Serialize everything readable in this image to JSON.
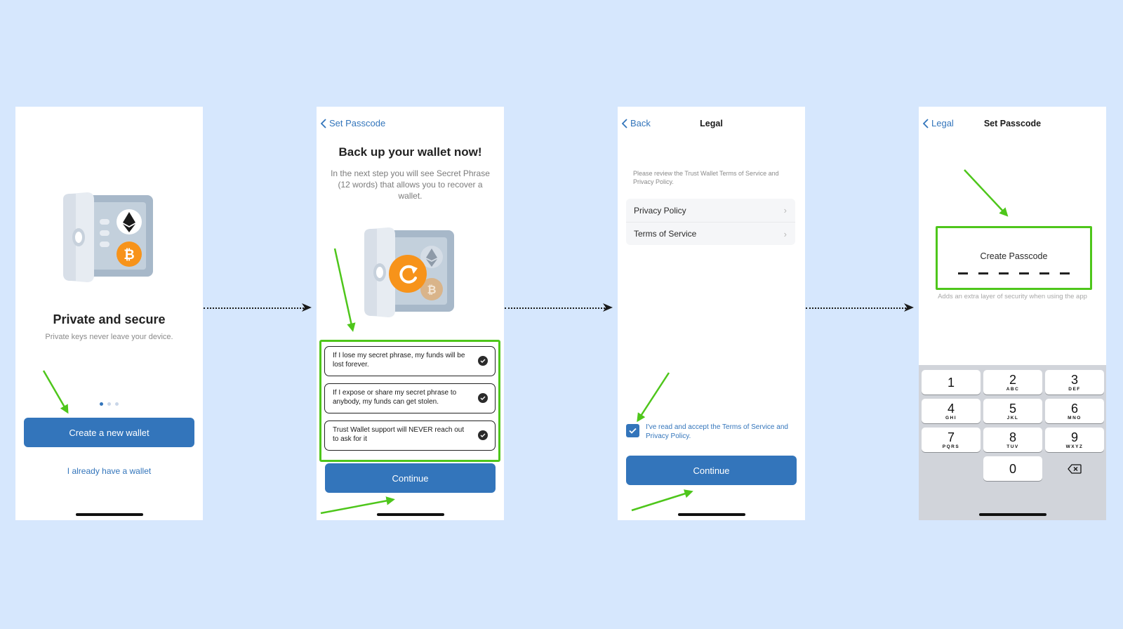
{
  "screen1": {
    "title": "Private and secure",
    "subtitle": "Private keys never leave your device.",
    "create_button": "Create a new wallet",
    "have_wallet_link": "I already have a wallet"
  },
  "screen2": {
    "back_label": "Set Passcode",
    "title": "Back up your wallet now!",
    "description": "In the next step you will see Secret Phrase (12 words) that allows you to recover a wallet.",
    "agreements": [
      "If I lose my secret phrase, my funds will be lost forever.",
      "If I expose or share my secret phrase to anybody, my funds can get stolen.",
      "Trust Wallet support will NEVER reach out to ask for it"
    ],
    "continue_button": "Continue"
  },
  "screen3": {
    "back_label": "Back",
    "title": "Legal",
    "review_text": "Please review the Trust Wallet Terms of Service and Privacy Policy.",
    "rows": [
      "Privacy Policy",
      "Terms of Service"
    ],
    "accept_text": "I've read and accept the Terms of Service and Privacy Policy.",
    "continue_button": "Continue"
  },
  "screen4": {
    "back_label": "Legal",
    "title": "Set Passcode",
    "create_label": "Create Passcode",
    "help_text": "Adds an extra layer of security when using the app",
    "keys": [
      {
        "num": "1",
        "letters": ""
      },
      {
        "num": "2",
        "letters": "ABC"
      },
      {
        "num": "3",
        "letters": "DEF"
      },
      {
        "num": "4",
        "letters": "GHI"
      },
      {
        "num": "5",
        "letters": "JKL"
      },
      {
        "num": "6",
        "letters": "MNO"
      },
      {
        "num": "7",
        "letters": "PQRS"
      },
      {
        "num": "8",
        "letters": "TUV"
      },
      {
        "num": "9",
        "letters": "WXYZ"
      },
      {
        "num": "0",
        "letters": ""
      }
    ]
  },
  "colors": {
    "background": "#d6e7fd",
    "accent_blue": "#3375bb",
    "highlight_green": "#4ec61b",
    "bitcoin_orange": "#f7931a"
  }
}
